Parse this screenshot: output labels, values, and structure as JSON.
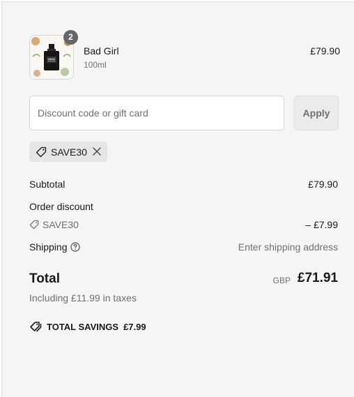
{
  "line_item": {
    "name": "Bad Girl",
    "variant": "100ml",
    "price": "£79.90",
    "quantity": "2",
    "image_icon": "perfume-bottle"
  },
  "discount": {
    "placeholder": "Discount code or gift card",
    "value": "",
    "apply_label": "Apply",
    "applied_code": "SAVE30"
  },
  "summary": {
    "subtotal_label": "Subtotal",
    "subtotal_value": "£79.90",
    "order_discount_label": "Order discount",
    "discount_code": "SAVE30",
    "discount_value": "– £7.99",
    "shipping_label": "Shipping",
    "shipping_value": "Enter shipping address",
    "total_label": "Total",
    "currency": "GBP",
    "total_value": "£71.91",
    "taxes_text": "Including £11.99 in taxes",
    "savings_label": "TOTAL SAVINGS",
    "savings_value": "£7.99"
  },
  "colors": {
    "panel_bg": "#f5f5f5",
    "badge_bg": "#666666",
    "chip_bg": "#e6e6e6",
    "muted_text": "#707070"
  }
}
